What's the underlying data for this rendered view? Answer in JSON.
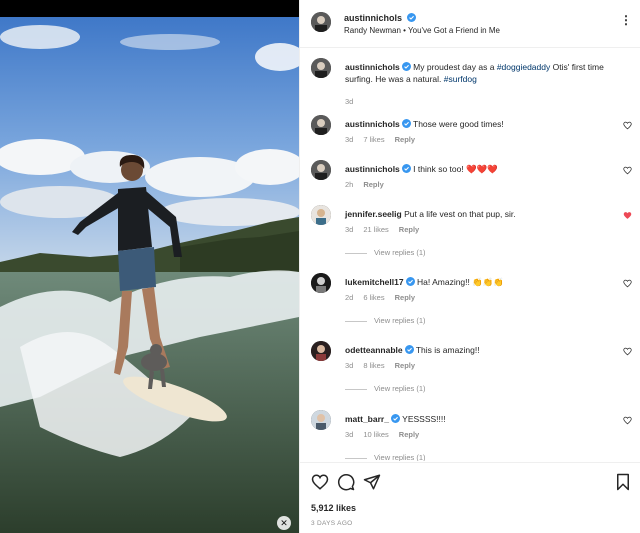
{
  "post": {
    "username": "austinnichols",
    "audio": "Randy Newman • You've Got a Friend in Me",
    "caption": {
      "username": "austinnichols",
      "text_before": "My proudest day as a ",
      "hashtag1": "#doggiedaddy",
      "text_middle": " Otis' first time surfing. He was a natural. ",
      "hashtag2": "#surfdog",
      "time": "3d"
    },
    "likes": "5,912 likes",
    "posted_ago": "3 DAYS AGO"
  },
  "comments": [
    {
      "username": "austinnichols",
      "text": "Those were good times!",
      "time": "3d",
      "likes": "7 likes",
      "reply": "Reply",
      "liked": false,
      "verified": true
    },
    {
      "username": "austinnichols",
      "text": "I think so too! ❤️❤️❤️",
      "time": "2h",
      "likes": "",
      "reply": "Reply",
      "liked": false,
      "verified": true
    },
    {
      "username": "jennifer.seelig",
      "text": "Put a life vest on that pup, sir.",
      "time": "3d",
      "likes": "21 likes",
      "reply": "Reply",
      "liked": true,
      "verified": false,
      "view_replies": "View replies (1)"
    },
    {
      "username": "lukemitchell17",
      "text": "Ha! Amazing!! 👏👏👏",
      "time": "2d",
      "likes": "6 likes",
      "reply": "Reply",
      "liked": false,
      "verified": true,
      "view_replies": "View replies (1)"
    },
    {
      "username": "odetteannable",
      "text": "This is amazing!!",
      "time": "3d",
      "likes": "8 likes",
      "reply": "Reply",
      "liked": false,
      "verified": true,
      "view_replies": "View replies (1)"
    },
    {
      "username": "matt_barr_",
      "text": "YESSSS!!!!",
      "time": "3d",
      "likes": "10 likes",
      "reply": "Reply",
      "liked": false,
      "verified": true,
      "view_replies": "View replies (1)"
    }
  ],
  "icons": {
    "more": "more-options-icon",
    "like": "heart-icon",
    "comment": "comment-icon",
    "share": "share-icon",
    "save": "bookmark-icon",
    "verified": "verified-badge-icon"
  },
  "colors": {
    "verified": "#3897f0",
    "liked": "#ed4956",
    "hashtag": "#00376b",
    "muted": "#8e8e8e"
  }
}
